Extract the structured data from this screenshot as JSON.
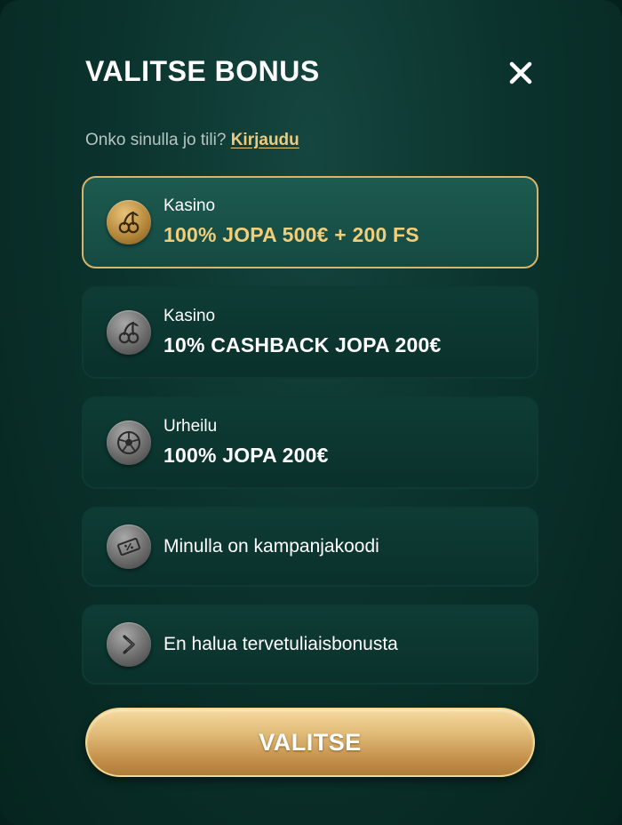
{
  "modal": {
    "title": "VALITSE BONUS",
    "login_prompt": "Onko sinulla jo tili?",
    "login_link": "Kirjaudu",
    "close_icon": "close-icon"
  },
  "options": [
    {
      "category": "Kasino",
      "offer": "100% JOPA 500€ + 200 FS",
      "icon": "cherries-icon",
      "selected": true
    },
    {
      "category": "Kasino",
      "offer": "10% CASHBACK JOPA 200€",
      "icon": "cherries-icon",
      "selected": false
    },
    {
      "category": "Urheilu",
      "offer": "100% JOPA 200€",
      "icon": "soccer-ball-icon",
      "selected": false
    },
    {
      "label": "Minulla on kampanjakoodi",
      "icon": "promo-ticket-icon",
      "selected": false
    },
    {
      "label": "En halua tervetuliaisbonusta",
      "icon": "chevron-right-icon",
      "selected": false
    }
  ],
  "submit": {
    "label": "VALITSE"
  },
  "colors": {
    "accent_gold": "#f1ce7a",
    "link_gold": "#eccb7e",
    "background": "#0b332d",
    "selected_border": "#d8b56a"
  }
}
